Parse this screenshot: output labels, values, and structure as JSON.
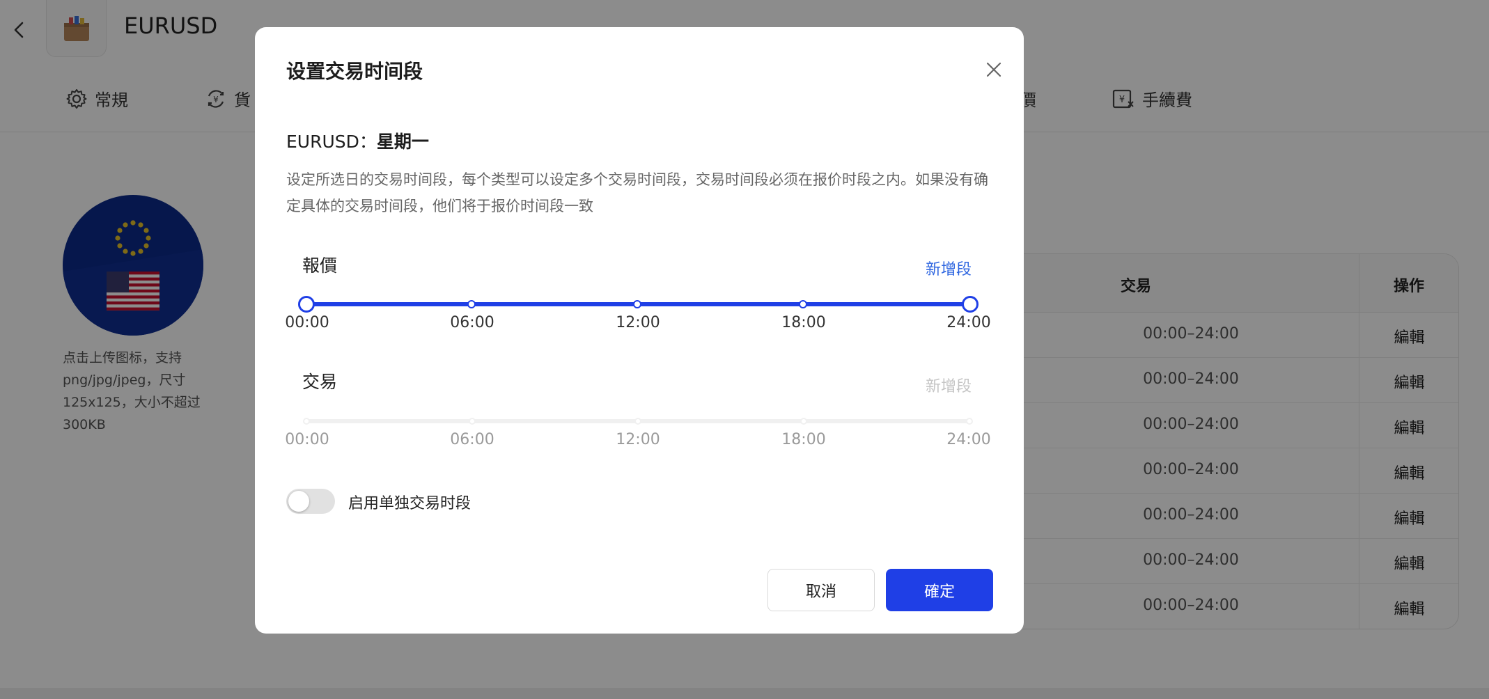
{
  "header": {
    "title": "EURUSD",
    "back_icon": "chevron-left-icon",
    "logo_icon": "package-box-icon"
  },
  "tabs": [
    {
      "label": "常規",
      "icon": "gear-icon"
    },
    {
      "label": "貨",
      "icon": "currency-exchange-icon"
    },
    {
      "label": "價",
      "icon": ""
    },
    {
      "label": "手續費",
      "icon": "fee-receipt-icon"
    }
  ],
  "symbol_image": {
    "icon": "eu-us-flag-icon",
    "upload_hint": "点击上传图标，支持png/jpg/jpeg，尺寸125x125，大小不超过300KB"
  },
  "schedule_table": {
    "headers": {
      "trade": "交易",
      "action": "操作"
    },
    "rows": [
      {
        "trade": "00:00–24:00",
        "action": "編輯"
      },
      {
        "trade": "00:00–24:00",
        "action": "編輯"
      },
      {
        "trade": "00:00–24:00",
        "action": "編輯"
      },
      {
        "trade": "00:00–24:00",
        "action": "編輯"
      },
      {
        "trade": "00:00–24:00",
        "action": "編輯"
      },
      {
        "trade": "00:00–24:00",
        "action": "編輯"
      },
      {
        "trade": "00:00–24:00",
        "action": "編輯"
      }
    ]
  },
  "modal": {
    "title": "设置交易时间段",
    "close_icon": "close-icon",
    "symbol": "EURUSD：",
    "day": "星期一",
    "description": "设定所选日的交易时间段，每个类型可以设定多个交易时间段，交易时间段必须在报价时段之内。如果没有确定具体的交易时间段，他们将于报价时间段一致",
    "quote": {
      "label": "報價",
      "add_label": "新增段",
      "range_start": "00:00",
      "range_end": "24:00",
      "ticks": [
        "00:00",
        "06:00",
        "12:00",
        "18:00",
        "24:00"
      ]
    },
    "trade": {
      "label": "交易",
      "add_label": "新增段",
      "ticks": [
        "00:00",
        "06:00",
        "12:00",
        "18:00",
        "24:00"
      ]
    },
    "toggle": {
      "label": "启用单独交易时段",
      "on": false
    },
    "cancel_label": "取消",
    "ok_label": "確定"
  },
  "colors": {
    "accent": "#1f3fe6",
    "link": "#2d65e0",
    "overlay": "rgba(0,0,0,0.45)"
  }
}
